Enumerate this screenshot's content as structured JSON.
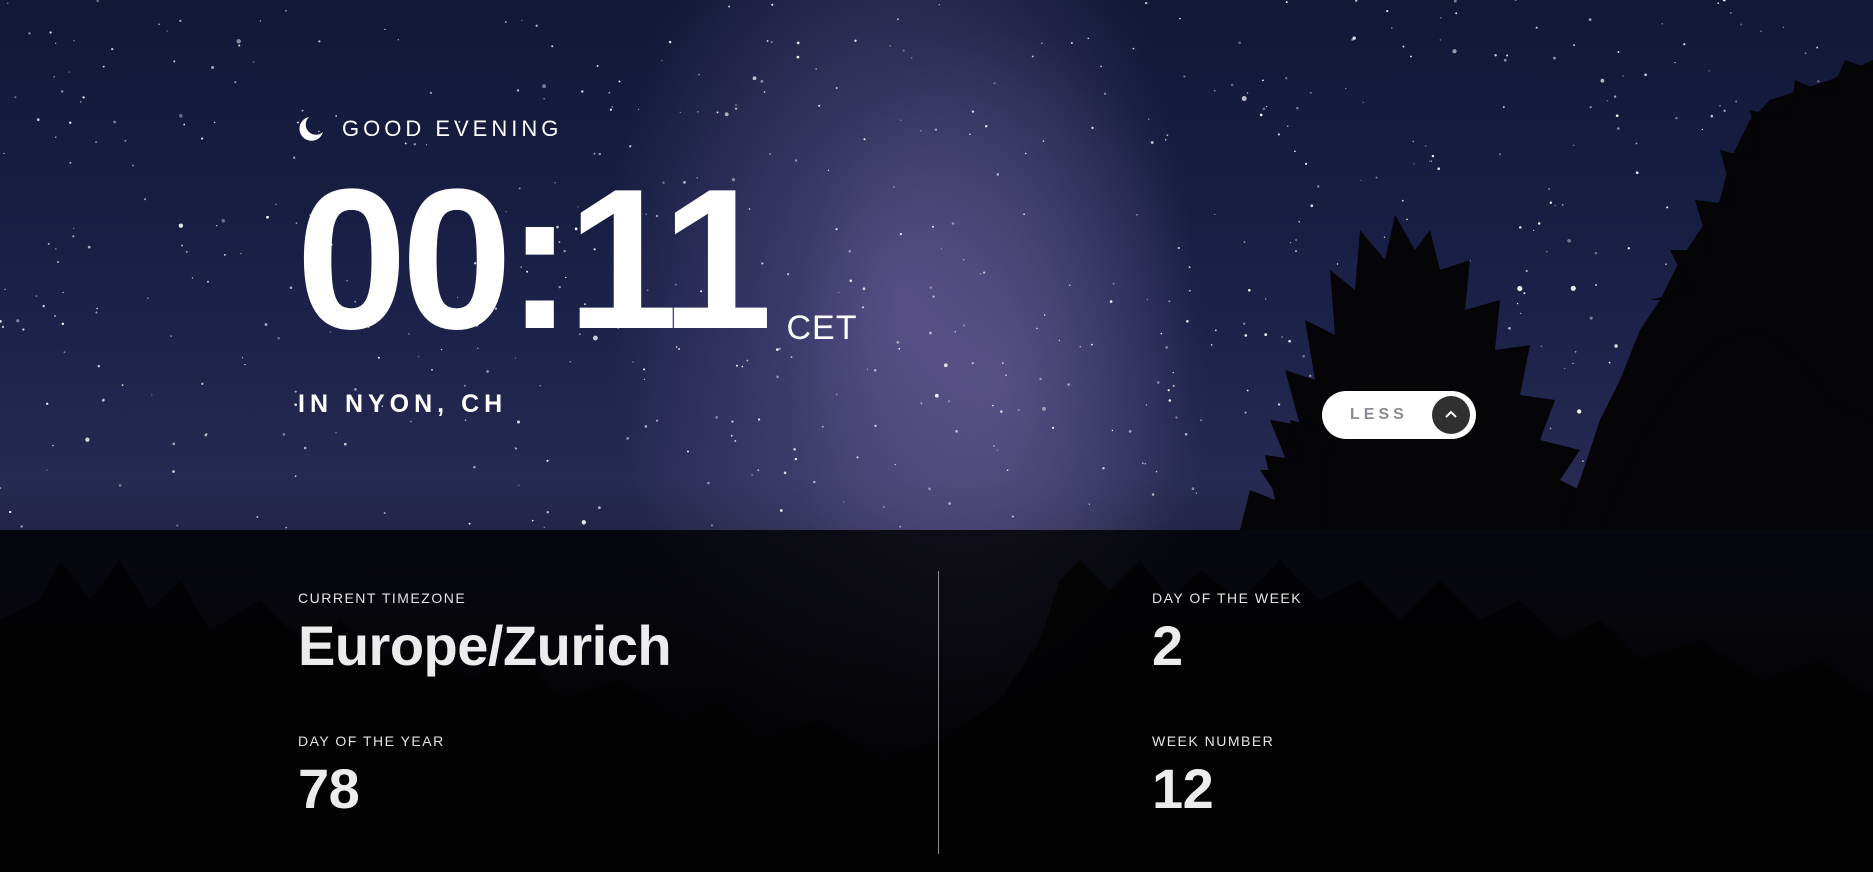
{
  "greeting": {
    "icon": "moon-icon",
    "text": "GOOD EVENING"
  },
  "clock": {
    "time": "00:11",
    "timezone_abbr": "CET"
  },
  "location": "IN NYON, CH",
  "toggle": {
    "label": "LESS",
    "icon": "chevron-up-icon"
  },
  "details": {
    "current_timezone": {
      "label": "CURRENT TIMEZONE",
      "value": "Europe/Zurich"
    },
    "day_of_year": {
      "label": "DAY OF THE YEAR",
      "value": "78"
    },
    "day_of_week": {
      "label": "DAY OF THE WEEK",
      "value": "2"
    },
    "week_number": {
      "label": "WEEK NUMBER",
      "value": "12"
    }
  },
  "colors": {
    "panel_bg": "#000000",
    "button_bg": "#ffffff",
    "button_circle": "#303030",
    "text": "#ffffff"
  }
}
